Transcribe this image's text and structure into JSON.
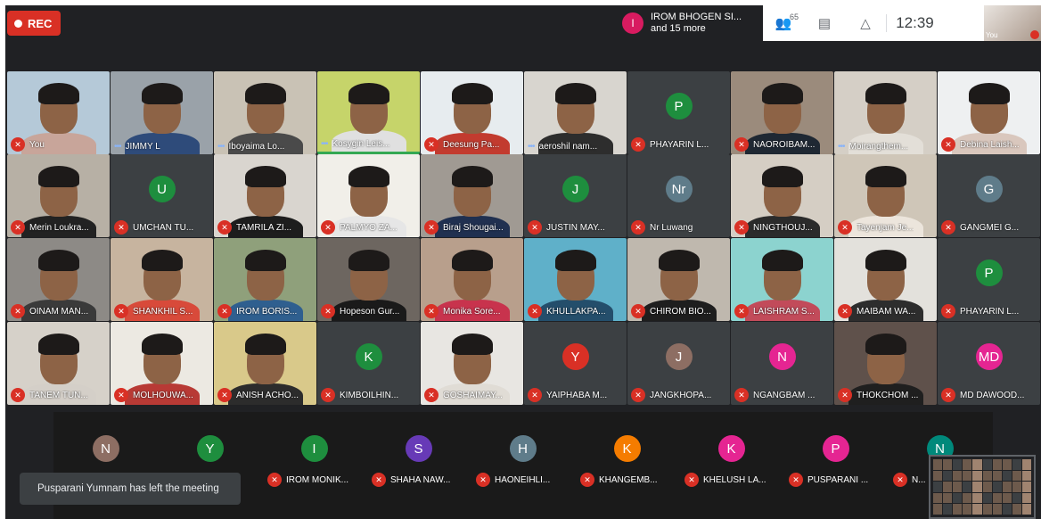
{
  "recording": {
    "label": "REC"
  },
  "presenter": {
    "initial": "I",
    "name": "IROM BHOGEN SI...",
    "more": "and 15 more"
  },
  "controls": {
    "participants_count": "65",
    "clock": "12:39"
  },
  "self_view": {
    "label": "You"
  },
  "colors": {
    "muted_red": "#d93025",
    "talk_blue": "#8ab4f8",
    "background": "#202124",
    "control_bar": "#ffffff"
  },
  "grid": [
    {
      "name": "You",
      "muted": true,
      "kind": "photo",
      "bg": "#b5c9d8",
      "shirt": "#c8a59a"
    },
    {
      "name": "JIMMY L",
      "muted": false,
      "talking": true,
      "kind": "photo",
      "bg": "#9aa2a9",
      "shirt": "#2e4b7a"
    },
    {
      "name": "Iboyaima Lo...",
      "muted": false,
      "talking": true,
      "kind": "photo",
      "bg": "#c9c2b5",
      "shirt": "#4a4a4a"
    },
    {
      "name": "Kosygin Leis...",
      "muted": false,
      "talking": true,
      "active": true,
      "kind": "photo",
      "bg": "#c6d46a",
      "shirt": "#e0e0e0"
    },
    {
      "name": "Deesung Pa...",
      "muted": true,
      "kind": "photo",
      "bg": "#e7ecef",
      "shirt": "#c23b2f"
    },
    {
      "name": "aeroshil nam...",
      "muted": false,
      "talking": true,
      "kind": "photo",
      "bg": "#d8d5cf",
      "shirt": "#2d2d2d"
    },
    {
      "name": "PHAYARIN L...",
      "muted": true,
      "kind": "letter",
      "letter": "P",
      "color": "#1e8e3e"
    },
    {
      "name": "NAOROIBAM...",
      "muted": true,
      "kind": "photo",
      "bg": "#9b8b7c",
      "shirt": "#1f2833"
    },
    {
      "name": "Moirangthem...",
      "muted": false,
      "talking": true,
      "kind": "photo",
      "bg": "#d5cfc6",
      "shirt": "#e3dfd8"
    },
    {
      "name": "Debina Laish...",
      "muted": true,
      "kind": "photo",
      "bg": "#eef0f1",
      "shirt": "#d9c7bd"
    },
    {
      "name": "Merin Loukra...",
      "muted": true,
      "kind": "photo",
      "bg": "#b7b0a5",
      "shirt": "#222222"
    },
    {
      "name": "UMCHAN TU...",
      "muted": true,
      "kind": "letter",
      "letter": "U",
      "color": "#1e8e3e"
    },
    {
      "name": "TAMRILA ZI...",
      "muted": true,
      "kind": "photo",
      "bg": "#d9d5cf",
      "shirt": "#1d1d1d"
    },
    {
      "name": "PALMYO ZA...",
      "muted": true,
      "kind": "photo",
      "bg": "#f1efe9",
      "shirt": "#e6e6e6"
    },
    {
      "name": "Biraj Shougai...",
      "muted": true,
      "kind": "photo",
      "bg": "#a09a93",
      "shirt": "#203050"
    },
    {
      "name": "JUSTIN MAY...",
      "muted": true,
      "kind": "letter",
      "letter": "J",
      "color": "#1e8e3e"
    },
    {
      "name": "Nr Luwang",
      "muted": true,
      "kind": "letter",
      "letter": "Nr",
      "color": "#5f7c8a"
    },
    {
      "name": "NINGTHOUJ...",
      "muted": true,
      "kind": "photo",
      "bg": "#d5cec4",
      "shirt": "#2b2b2b"
    },
    {
      "name": "Tayenjam Je...",
      "muted": true,
      "kind": "photo",
      "bg": "#cfc6b8",
      "shirt": "#ece5dc"
    },
    {
      "name": "GANGMEI G...",
      "muted": true,
      "kind": "letter",
      "letter": "G",
      "color": "#5f7c8a"
    },
    {
      "name": "OINAM MAN...",
      "muted": true,
      "kind": "photo",
      "bg": "#8d8a86",
      "shirt": "#3a3a3a"
    },
    {
      "name": "SHANKHIL S...",
      "muted": true,
      "kind": "photo",
      "bg": "#c7b49f",
      "shirt": "#d84a3a"
    },
    {
      "name": "IROM BORIS...",
      "muted": true,
      "kind": "photo",
      "bg": "#8fa07b",
      "shirt": "#2f5f8f"
    },
    {
      "name": "Hopeson Gur...",
      "muted": true,
      "kind": "photo",
      "bg": "#6d6660",
      "shirt": "#1a1a1a"
    },
    {
      "name": "Monika Sore...",
      "muted": true,
      "kind": "photo",
      "bg": "#b89f8c",
      "shirt": "#c8334d"
    },
    {
      "name": "KHULLAKPA...",
      "muted": true,
      "kind": "photo",
      "bg": "#5fb0c9",
      "shirt": "#244e6b"
    },
    {
      "name": "CHIROM BIO...",
      "muted": true,
      "kind": "photo",
      "bg": "#bfb8ae",
      "shirt": "#1e1e1e"
    },
    {
      "name": "LAISHRAM S...",
      "muted": true,
      "kind": "photo",
      "bg": "#8cd3cf",
      "shirt": "#c24b5a"
    },
    {
      "name": "MAIBAM WA...",
      "muted": true,
      "kind": "photo",
      "bg": "#e3e1dc",
      "shirt": "#2d2d2d"
    },
    {
      "name": "PHAYARIN L...",
      "muted": true,
      "kind": "letter",
      "letter": "P",
      "color": "#1e8e3e"
    },
    {
      "name": "TANEM TUN...",
      "muted": true,
      "kind": "photo",
      "bg": "#d6d1c9",
      "shirt": "#d4cfc8"
    },
    {
      "name": "MOLHOUWA...",
      "muted": true,
      "kind": "photo",
      "bg": "#ece9e2",
      "shirt": "#b83a35"
    },
    {
      "name": "ANISH ACHO...",
      "muted": true,
      "kind": "photo",
      "bg": "#d9c98a",
      "shirt": "#2c2c2c"
    },
    {
      "name": "KIMBOILHIN...",
      "muted": true,
      "kind": "letter",
      "letter": "K",
      "color": "#1e8e3e"
    },
    {
      "name": "GOSHAIMAY...",
      "muted": true,
      "kind": "photo",
      "bg": "#e8e6e2",
      "shirt": "#e0dcd5"
    },
    {
      "name": "YAIPHABA M...",
      "muted": true,
      "kind": "letter",
      "letter": "Y",
      "color": "#d93025"
    },
    {
      "name": "JANGKHOPA...",
      "muted": true,
      "kind": "letter",
      "letter": "J",
      "color": "#8d6e63"
    },
    {
      "name": "NGANGBAM ...",
      "muted": true,
      "kind": "letter",
      "letter": "N",
      "color": "#e52592"
    },
    {
      "name": "THOKCHOM ...",
      "muted": true,
      "kind": "photo",
      "bg": "#5f514b",
      "shirt": "#1f1f1f"
    },
    {
      "name": "MD DAWOOD...",
      "muted": true,
      "kind": "letter",
      "letter": "MD",
      "color": "#e52592"
    }
  ],
  "bottom_strip": [
    {
      "name": "",
      "letter": "N",
      "color": "#8d6e63"
    },
    {
      "name": "S...",
      "letter": "Y",
      "color": "#1e8e3e"
    },
    {
      "name": "IROM MONIK...",
      "letter": "I",
      "color": "#1e8e3e"
    },
    {
      "name": "SHAHA NAW...",
      "letter": "S",
      "color": "#673ab7"
    },
    {
      "name": "HAONEIHLI...",
      "letter": "H",
      "color": "#5f7c8a"
    },
    {
      "name": "KHANGEMB...",
      "letter": "K",
      "color": "#f57c00"
    },
    {
      "name": "KHELUSH LA...",
      "letter": "K",
      "color": "#e52592"
    },
    {
      "name": "PUSPARANI ...",
      "letter": "P",
      "color": "#e52592"
    },
    {
      "name": "N...",
      "letter": "N",
      "color": "#00897b"
    }
  ],
  "toast": {
    "message": "Pusparani Yumnam has left the meeting"
  }
}
